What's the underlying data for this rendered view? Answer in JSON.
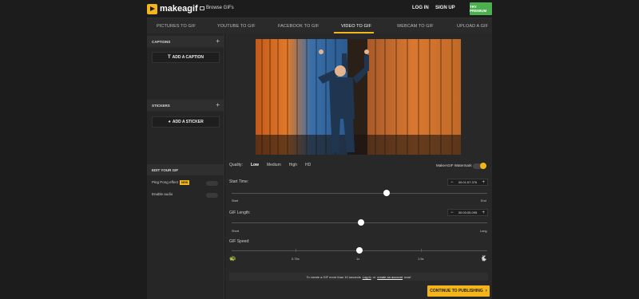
{
  "header": {
    "logo_text": "makeagif",
    "browse_label": "Browse GIFs",
    "login_label": "LOG IN",
    "signup_label": "SIGN UP",
    "premium_label": "TRY PREMIUM",
    "brand_color": "#f3b519",
    "premium_color": "#4caf50"
  },
  "tabs": [
    {
      "label": "PICTURES TO GIF"
    },
    {
      "label": "YOUTUBE TO GIF"
    },
    {
      "label": "FACEBOOK TO GIF"
    },
    {
      "label": "VIDEO TO GIF",
      "active": true
    },
    {
      "label": "WEBCAM TO GIF"
    },
    {
      "label": "UPLOAD A GIF"
    }
  ],
  "sidebar": {
    "captions": {
      "title": "CAPTIONS",
      "button": "ADD A CAPTION"
    },
    "stickers": {
      "title": "STICKERS",
      "button": "ADD A STICKER"
    },
    "edit": {
      "title": "EDIT YOUR GIF",
      "ping_pong": "Ping Pong effect",
      "new_badge": "NEW",
      "enable_audio": "Enable audio"
    }
  },
  "quality": {
    "label": "Quality:",
    "options": [
      "Low",
      "Medium",
      "High",
      "HD"
    ],
    "selected": "Low"
  },
  "watermark": {
    "label": "MakeAGIF Watermark",
    "enabled": true
  },
  "start_time": {
    "label": "Start Time:",
    "value": "00:01:57.376",
    "min_label": "Start",
    "max_label": "End",
    "position": 0.605
  },
  "gif_length": {
    "label": "GIF Length:",
    "value": "00:00:05.095",
    "min_label": "Short",
    "max_label": "Long",
    "position": 0.505
  },
  "gif_speed": {
    "label": "GIF Speed:",
    "ticks": [
      "0.75x",
      "1x",
      "1.5x"
    ],
    "position": 0.5
  },
  "notice": {
    "prefix": "To create a GIF more than 10 seconds",
    "link1": "Log in",
    "mid": "or",
    "link2": "create an account",
    "suffix": "now!"
  },
  "continue_label": "CONTINUE TO PUBLISHING"
}
